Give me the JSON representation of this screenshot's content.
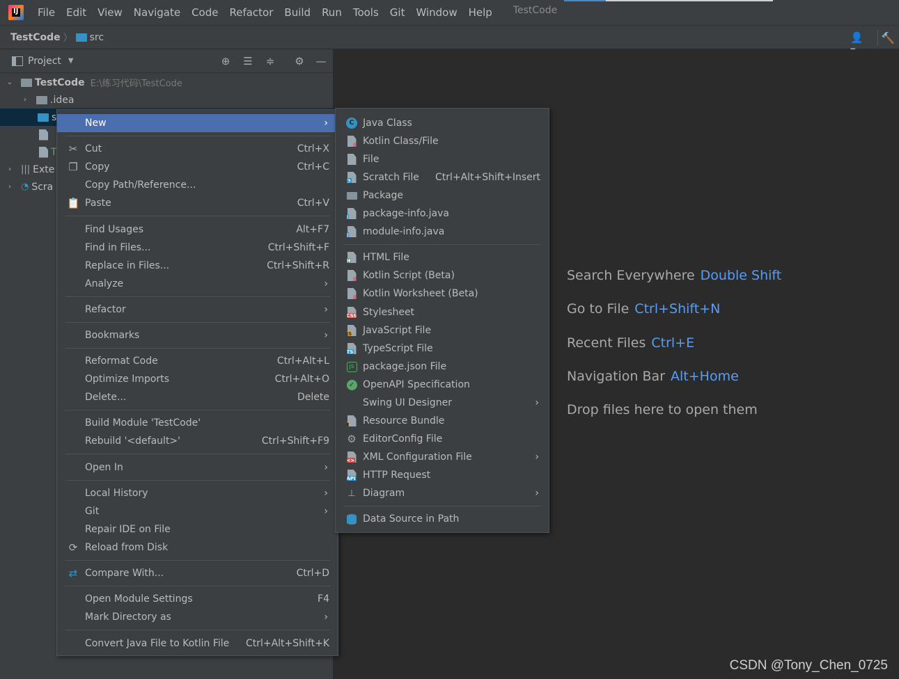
{
  "menubar": {
    "logo_letter": "IJ",
    "items": [
      "File",
      "Edit",
      "View",
      "Navigate",
      "Code",
      "Refactor",
      "Build",
      "Run",
      "Tools",
      "Git",
      "Window",
      "Help"
    ],
    "window_title": "TestCode"
  },
  "navbar": {
    "project": "TestCode",
    "folder": "src"
  },
  "project_panel": {
    "title": "Project",
    "tree": {
      "root_label": "TestCode",
      "root_path": "E:\\练习代码\\TestCode",
      "idea": ".idea",
      "src_partial": "s",
      "ext_libs": "Exte",
      "scratches": "Scra",
      "partial_1": "",
      "partial_2": "T"
    }
  },
  "context_menu": {
    "new": "New",
    "cut": "Cut",
    "cut_sc": "Ctrl+X",
    "copy": "Copy",
    "copy_sc": "Ctrl+C",
    "copy_path": "Copy Path/Reference...",
    "paste": "Paste",
    "paste_sc": "Ctrl+V",
    "find_usages": "Find Usages",
    "find_usages_sc": "Alt+F7",
    "find_in_files": "Find in Files...",
    "find_in_files_sc": "Ctrl+Shift+F",
    "replace_in_files": "Replace in Files...",
    "replace_in_files_sc": "Ctrl+Shift+R",
    "analyze": "Analyze",
    "refactor": "Refactor",
    "bookmarks": "Bookmarks",
    "reformat": "Reformat Code",
    "reformat_sc": "Ctrl+Alt+L",
    "optimize": "Optimize Imports",
    "optimize_sc": "Ctrl+Alt+O",
    "delete": "Delete...",
    "delete_sc": "Delete",
    "build_module": "Build Module 'TestCode'",
    "rebuild": "Rebuild '<default>'",
    "rebuild_sc": "Ctrl+Shift+F9",
    "open_in": "Open In",
    "local_history": "Local History",
    "git": "Git",
    "repair_ide": "Repair IDE on File",
    "reload": "Reload from Disk",
    "compare": "Compare With...",
    "compare_sc": "Ctrl+D",
    "module_settings": "Open Module Settings",
    "module_settings_sc": "F4",
    "mark_dir": "Mark Directory as",
    "convert": "Convert Java File to Kotlin File",
    "convert_sc": "Ctrl+Alt+Shift+K"
  },
  "submenu": {
    "java_class": "Java Class",
    "kotlin_class": "Kotlin Class/File",
    "file": "File",
    "scratch": "Scratch File",
    "scratch_sc": "Ctrl+Alt+Shift+Insert",
    "package": "Package",
    "package_info": "package-info.java",
    "module_info": "module-info.java",
    "html": "HTML File",
    "kotlin_script": "Kotlin Script (Beta)",
    "kotlin_worksheet": "Kotlin Worksheet (Beta)",
    "stylesheet": "Stylesheet",
    "javascript": "JavaScript File",
    "typescript": "TypeScript File",
    "package_json": "package.json File",
    "openapi": "OpenAPI Specification",
    "swing": "Swing UI Designer",
    "resource_bundle": "Resource Bundle",
    "editorconfig": "EditorConfig File",
    "xml_config": "XML Configuration File",
    "http_request": "HTTP Request",
    "diagram": "Diagram",
    "datasource": "Data Source in Path"
  },
  "editor": {
    "hint1": "Search Everywhere",
    "hint1_key": "Double Shift",
    "hint2": "Go to File",
    "hint2_key": "Ctrl+Shift+N",
    "hint3": "Recent Files",
    "hint3_key": "Ctrl+E",
    "hint4": "Navigation Bar",
    "hint4_key": "Alt+Home",
    "hint5": "Drop files here to open them"
  },
  "watermark": "CSDN @Tony_Chen_0725",
  "colors": {
    "accent": "#4b6eaf",
    "link": "#589df6",
    "bg": "#2b2b2b",
    "panel": "#3c3f41"
  }
}
